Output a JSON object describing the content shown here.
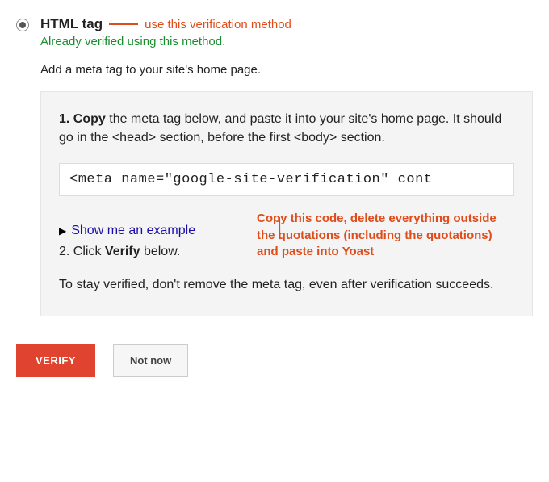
{
  "option": {
    "title": "HTML tag",
    "verified_msg": "Already verified using this method.",
    "description": "Add a meta tag to your site's home page."
  },
  "panel": {
    "step1_prefix_bold": "1. Copy",
    "step1_rest": " the meta tag below, and paste it into your site's home page. It should go in the <head> section, before the first <body> section.",
    "code": "<meta name=\"google-site-verification\" cont",
    "example_link": "Show me an example",
    "step2_prefix": "2. Click ",
    "step2_bold": "Verify",
    "step2_suffix": " below.",
    "stay_verified": "To stay verified, don't remove the meta tag, even after verification succeeds."
  },
  "buttons": {
    "verify": "VERIFY",
    "not_now": "Not now"
  },
  "annotations": {
    "use_method": "use this verification method",
    "copy_code": "Copy this code, delete everything outside the quotations (including the quotations) and paste into Yoast"
  }
}
